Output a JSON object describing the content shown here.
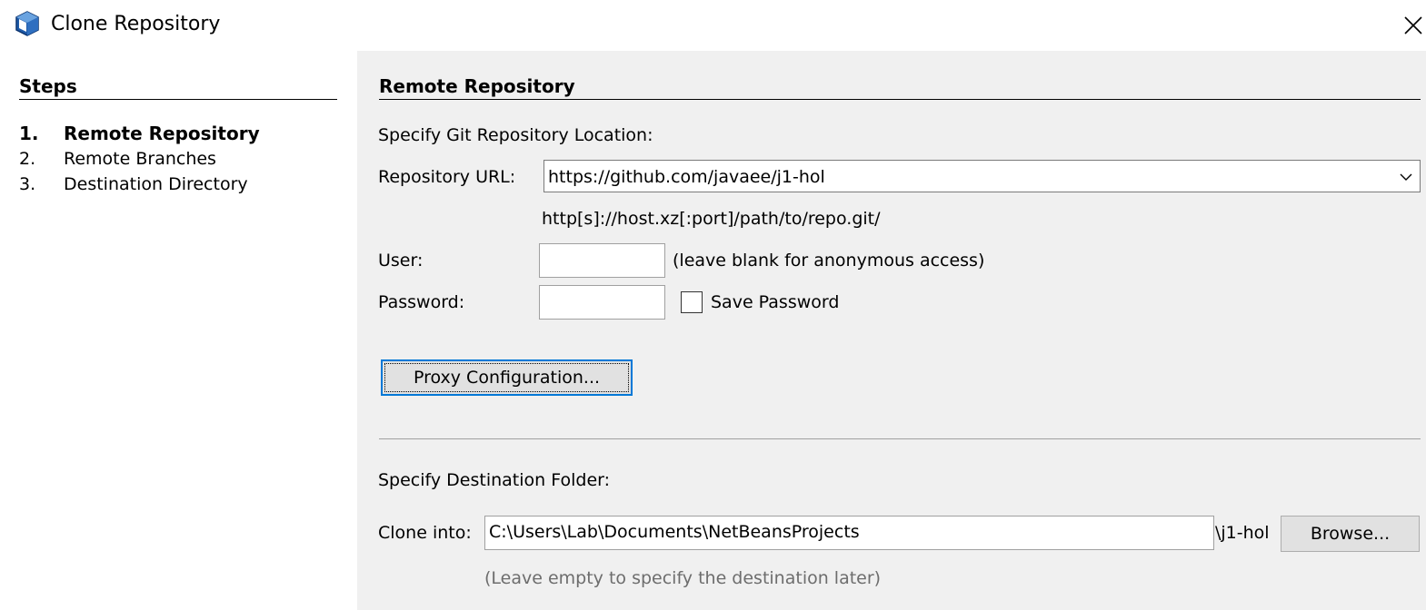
{
  "window": {
    "title": "Clone Repository"
  },
  "steps": {
    "heading": "Steps",
    "items": [
      {
        "num": "1.",
        "label": "Remote Repository",
        "current": true
      },
      {
        "num": "2.",
        "label": "Remote Branches",
        "current": false
      },
      {
        "num": "3.",
        "label": "Destination Directory",
        "current": false
      }
    ]
  },
  "panel": {
    "heading": "Remote Repository",
    "location_label": "Specify Git Repository Location:",
    "url_label": "Repository URL:",
    "url_value": "https://github.com/javaee/j1-hol",
    "url_hint": "http[s]://host.xz[:port]/path/to/repo.git/",
    "user_label": "User:",
    "user_value": "",
    "user_hint": "(leave blank for anonymous access)",
    "password_label": "Password:",
    "password_value": "",
    "save_password_label": "Save Password",
    "save_password_checked": false,
    "proxy_button": "Proxy Configuration...",
    "destination_label": "Specify Destination Folder:",
    "clone_into_label": "Clone into:",
    "clone_into_value": "C:\\Users\\Lab\\Documents\\NetBeansProjects",
    "clone_into_suffix": "\\j1-hol",
    "browse_button": "Browse...",
    "clone_hint": "(Leave empty to specify the destination later)"
  },
  "colors": {
    "panel_bg": "#f0f0f0",
    "focus_border": "#0078d7",
    "hint_gray": "#6d6d6d"
  },
  "icons": {
    "app": "netbeans-cube-icon",
    "close": "close-icon",
    "combo": "chevron-down-icon"
  }
}
